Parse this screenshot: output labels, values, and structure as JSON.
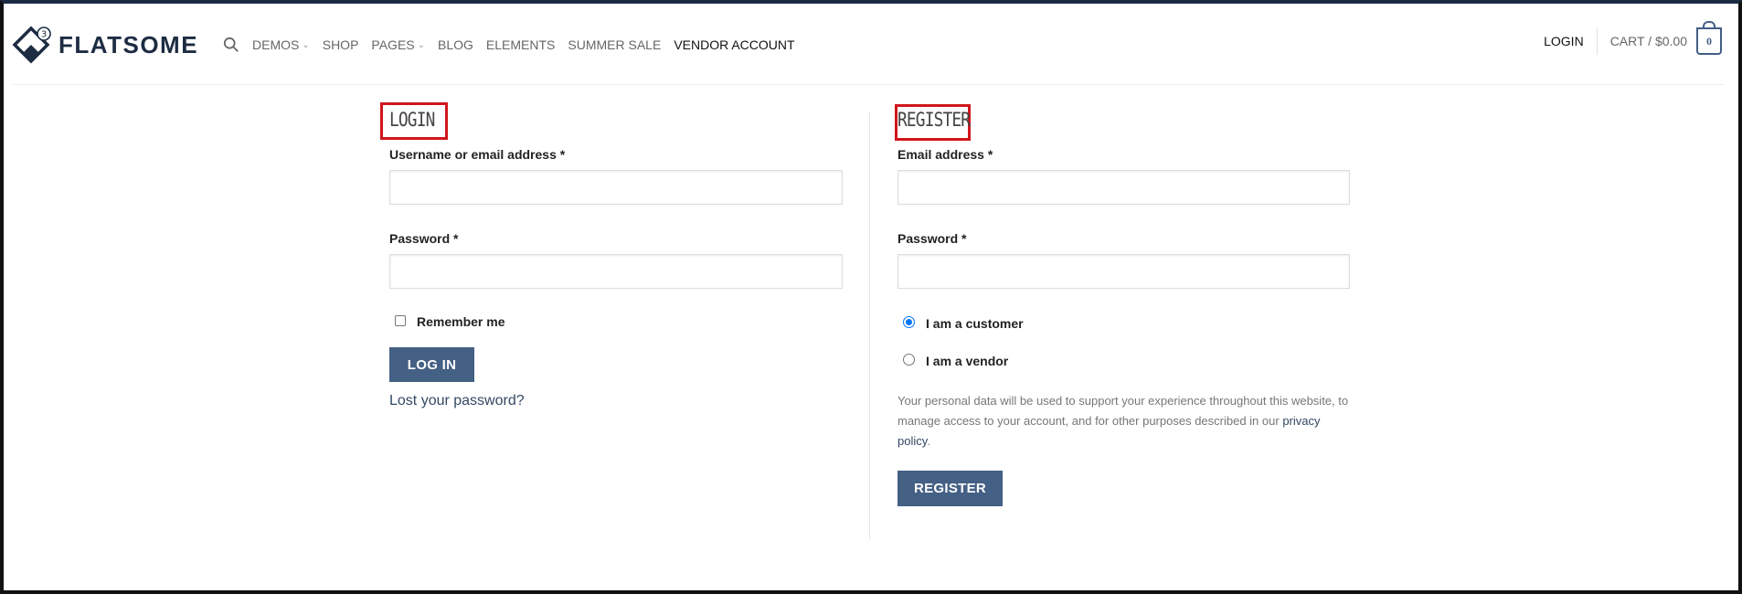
{
  "header": {
    "logo_badge": "3",
    "logo_text": "FLATSOME",
    "nav": [
      {
        "label": "DEMOS",
        "has_dropdown": true
      },
      {
        "label": "SHOP",
        "has_dropdown": false
      },
      {
        "label": "PAGES",
        "has_dropdown": true
      },
      {
        "label": "BLOG",
        "has_dropdown": false
      },
      {
        "label": "ELEMENTS",
        "has_dropdown": false
      },
      {
        "label": "SUMMER SALE",
        "has_dropdown": false
      },
      {
        "label": "VENDOR ACCOUNT",
        "has_dropdown": false
      }
    ],
    "login_label": "LOGIN",
    "cart_label": "CART / $0.00",
    "cart_count": "0",
    "icons": {
      "search": "search-icon",
      "cart": "cart-icon",
      "chevron": "chevron-down-icon"
    }
  },
  "login": {
    "title": "LOGIN",
    "username_label": "Username or email address *",
    "username_value": "",
    "password_label": "Password *",
    "password_value": "",
    "remember_label": "Remember me",
    "remember_checked": false,
    "submit_label": "LOG IN",
    "lost_password_label": "Lost your password?"
  },
  "register": {
    "title": "REGISTER",
    "email_label": "Email address *",
    "email_value": "",
    "password_label": "Password *",
    "password_value": "",
    "role_customer_label": "I am a customer",
    "role_vendor_label": "I am a vendor",
    "selected_role": "customer",
    "privacy_text": "Your personal data will be used to support your experience throughout this website, to manage access to your account, and for other purposes described in our",
    "privacy_link_label": "privacy policy",
    "privacy_end": ".",
    "submit_label": "REGISTER"
  },
  "colors": {
    "primary_button": "#446084",
    "highlight_box": "#d0161c",
    "radio_selected": "#0075ff",
    "logo": "#1d2c42"
  }
}
